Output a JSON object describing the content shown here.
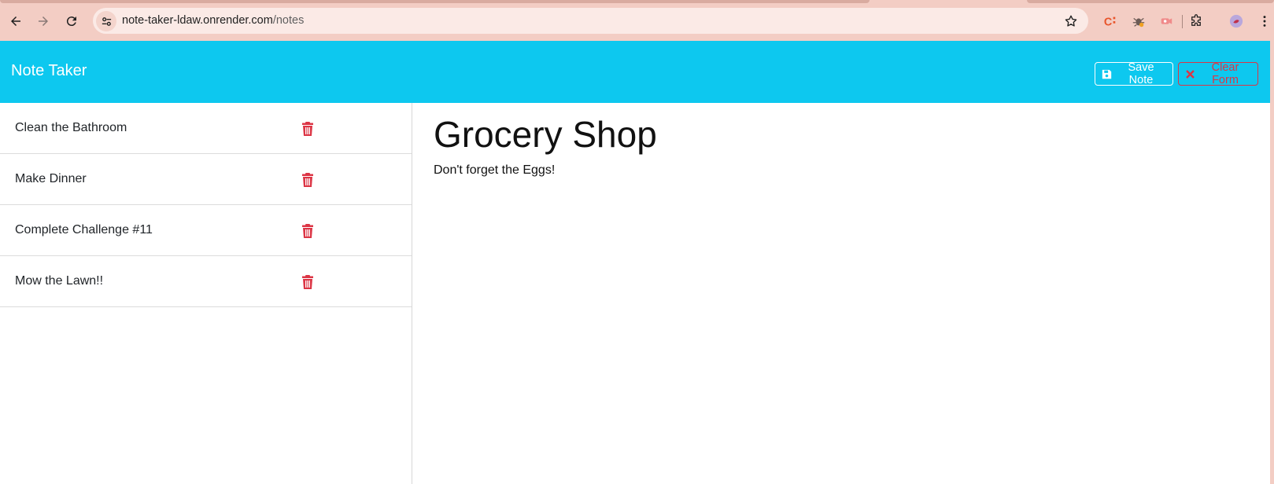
{
  "browser": {
    "url_host": "note-taker-ldaw.onrender.com",
    "url_path": "/notes"
  },
  "app": {
    "brand": "Note Taker",
    "save_label": "Save Note",
    "clear_label": "Clear Form",
    "save_icon": "floppy-disk-icon",
    "clear_icon": "x-icon",
    "delete_icon": "trash-icon",
    "danger_color": "#dc3545",
    "navbar_color": "#0dc8ef"
  },
  "notes": [
    {
      "title": "Clean the Bathroom"
    },
    {
      "title": "Make Dinner"
    },
    {
      "title": "Complete Challenge #11"
    },
    {
      "title": "Mow the Lawn!!"
    }
  ],
  "editor": {
    "title": "Grocery Shop",
    "body": "Don't forget the Eggs!"
  }
}
